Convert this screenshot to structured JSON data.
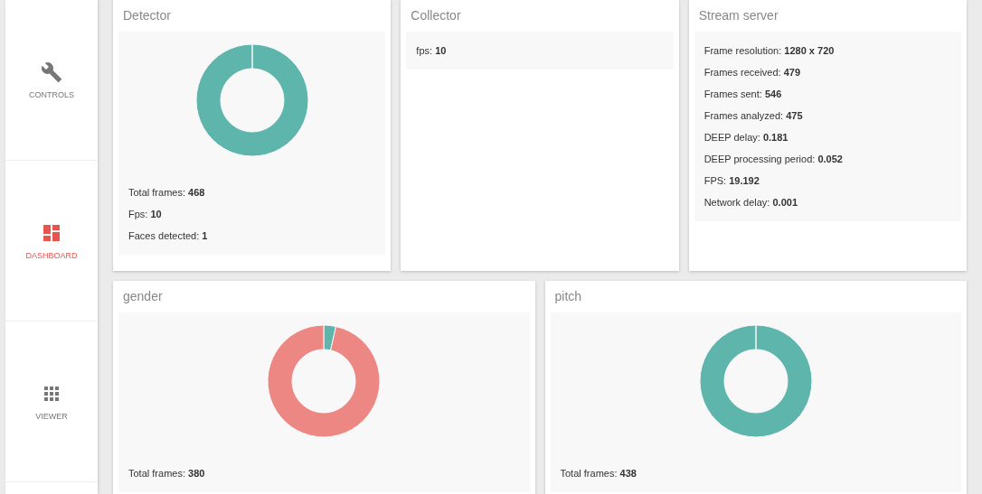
{
  "sidebar": {
    "items": [
      {
        "kind": "controls",
        "label": "CONTROLS",
        "selected": false
      },
      {
        "kind": "dashboard",
        "label": "DASHBOARD",
        "selected": true
      },
      {
        "kind": "viewer",
        "label": "VIEWER",
        "selected": false
      }
    ]
  },
  "top_cards": [
    {
      "title": "Detector",
      "donut": {
        "kind": "full"
      },
      "stats": [
        {
          "label": "Total frames:",
          "value": "468"
        },
        {
          "label": "Fps:",
          "value": "10"
        },
        {
          "label": "Faces detected:",
          "value": "1"
        }
      ]
    },
    {
      "title": "Collector",
      "stats": [
        {
          "label": "fps:",
          "value": "10"
        }
      ]
    },
    {
      "title": "Stream server",
      "stats": [
        {
          "label": "Frame resolution:",
          "value": "1280 x 720"
        },
        {
          "label": "Frames received:",
          "value": "479"
        },
        {
          "label": "Frames sent:",
          "value": "546"
        },
        {
          "label": "Frames analyzed:",
          "value": "475"
        },
        {
          "label": "DEEP delay:",
          "value": "0.181"
        },
        {
          "label": "DEEP processing period:",
          "value": "0.052"
        },
        {
          "label": "FPS:",
          "value": "19.192"
        },
        {
          "label": "Network delay:",
          "value": "0.001"
        }
      ]
    }
  ],
  "bottom_cards": [
    {
      "title": "gender",
      "donut": {
        "kind": "split"
      },
      "stats": [
        {
          "label": "Total frames:",
          "value": "380"
        }
      ]
    },
    {
      "title": "pitch",
      "donut": {
        "kind": "full"
      },
      "stats": [
        {
          "label": "Total frames:",
          "value": "438"
        }
      ]
    }
  ]
}
